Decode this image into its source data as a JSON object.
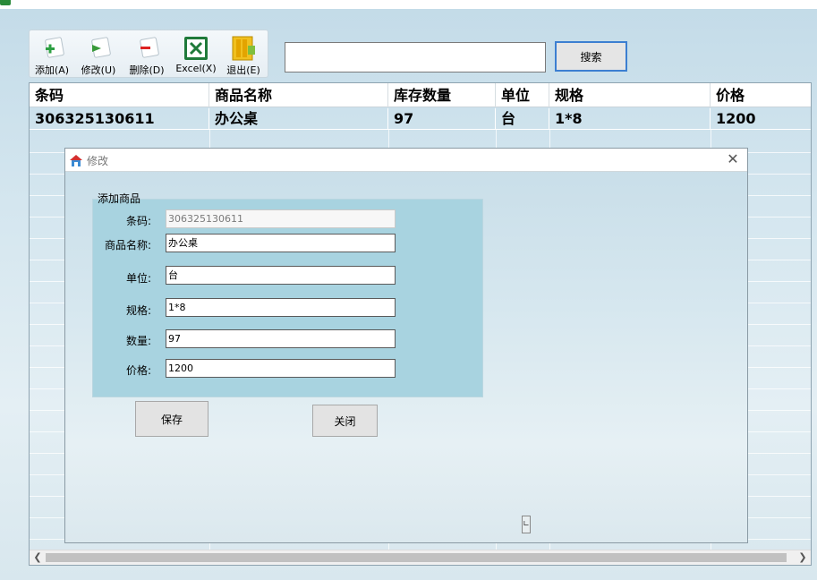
{
  "toolbar": {
    "add_label": "添加(A)",
    "edit_label": "修改(U)",
    "delete_label": "删除(D)",
    "excel_label": "Excel(X)",
    "exit_label": "退出(E)"
  },
  "search": {
    "value": "",
    "button_label": "搜索"
  },
  "grid": {
    "columns": [
      "条码",
      "商品名称",
      "库存数量",
      "单位",
      "规格",
      "价格"
    ],
    "rows": [
      [
        "306325130611",
        "办公桌",
        "97",
        "台",
        "1*8",
        "1200"
      ]
    ]
  },
  "dialog": {
    "title": "修改",
    "group_title": "添加商品",
    "fields": {
      "barcode": {
        "label": "条码:",
        "value": "306325130611"
      },
      "name": {
        "label": "商品名称:",
        "value": "办公桌"
      },
      "unit": {
        "label": "单位:",
        "value": "台"
      },
      "spec": {
        "label": "规格:",
        "value": "1*8"
      },
      "quantity": {
        "label": "数量:",
        "value": "97"
      },
      "price": {
        "label": "价格:",
        "value": "1200"
      }
    },
    "save_label": "保存",
    "close_label": "关闭"
  },
  "colors": {
    "accent": "#3c7fd1",
    "groupbox": "#a8d3e0",
    "background": "#d4e6ef"
  },
  "icons": [
    "app-icon",
    "add-icon",
    "edit-icon",
    "delete-icon",
    "excel-icon",
    "exit-icon",
    "dialog-icon",
    "close-icon",
    "scroll-left-icon",
    "scroll-right-icon"
  ]
}
